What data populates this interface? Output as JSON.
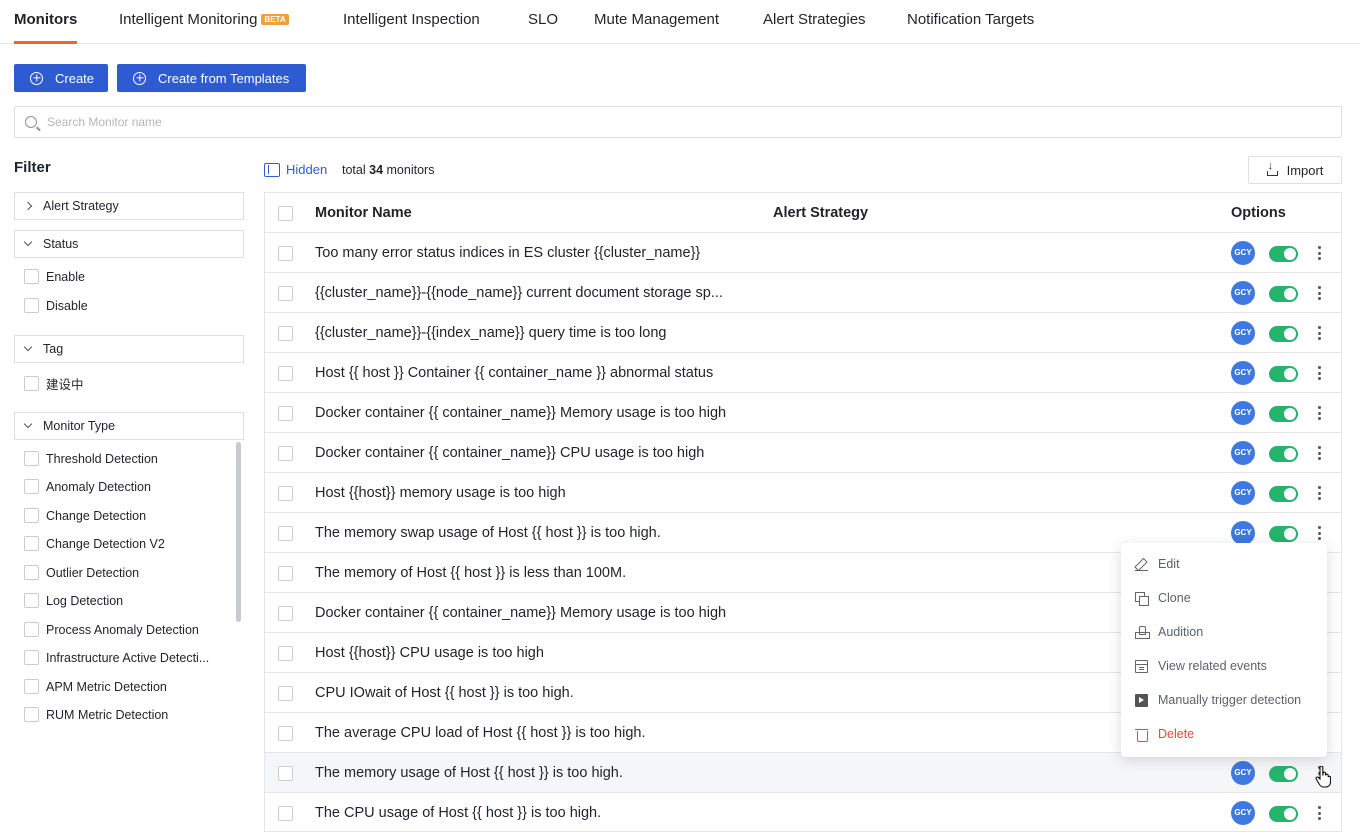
{
  "nav": {
    "tabs": [
      {
        "label": "Monitors",
        "active": true
      },
      {
        "label": "Intelligent Monitoring",
        "badge": "BETA"
      },
      {
        "label": "Intelligent Inspection"
      },
      {
        "label": "SLO"
      },
      {
        "label": "Mute Management"
      },
      {
        "label": "Alert Strategies"
      },
      {
        "label": "Notification Targets"
      }
    ]
  },
  "toolbar": {
    "create_label": "Create",
    "create_templates_label": "Create from Templates",
    "search_placeholder": "Search Monitor name",
    "hidden_label": "Hidden",
    "total_prefix": "total",
    "total_count": "34",
    "total_suffix": "monitors",
    "import_label": "Import"
  },
  "filter": {
    "title": "Filter",
    "groups": {
      "alert_strategy": "Alert Strategy",
      "status": "Status",
      "tag": "Tag",
      "monitor_type": "Monitor Type"
    },
    "status_options": [
      "Enable",
      "Disable"
    ],
    "tag_options": [
      "建设中"
    ],
    "type_options": [
      "Threshold Detection",
      "Anomaly Detection",
      "Change Detection",
      "Change Detection V2",
      "Outlier Detection",
      "Log Detection",
      "Process Anomaly Detection",
      "Infrastructure Active Detecti...",
      "APM Metric Detection",
      "RUM Metric Detection"
    ]
  },
  "table": {
    "columns": {
      "name": "Monitor Name",
      "strategy": "Alert Strategy",
      "options": "Options"
    },
    "avatar_text": "GCY",
    "rows": [
      {
        "name": "Too many error status indices in ES cluster {{cluster_name}}"
      },
      {
        "name": "{{cluster_name}}-{{node_name}} current document storage sp..."
      },
      {
        "name": "{{cluster_name}}-{{index_name}} query time is too long"
      },
      {
        "name": "Host {{ host }} Container {{ container_name }} abnormal status"
      },
      {
        "name": "Docker container {{ container_name}} Memory usage is too high"
      },
      {
        "name": "Docker container {{ container_name}} CPU usage is too high"
      },
      {
        "name": "Host {{host}} memory usage is too high"
      },
      {
        "name": "The memory swap usage of Host {{ host }} is too high."
      },
      {
        "name": "The memory of Host {{ host }} is less than 100M."
      },
      {
        "name": "Docker container {{ container_name}} Memory usage is too high"
      },
      {
        "name": "Host {{host}} CPU usage is too high"
      },
      {
        "name": "CPU IOwait of Host {{ host }} is too high."
      },
      {
        "name": "The average CPU load of Host {{ host }} is too high."
      },
      {
        "name": "The memory usage of Host {{ host }} is too high."
      },
      {
        "name": "The CPU usage of Host {{ host }} is too high."
      }
    ]
  },
  "menu": {
    "edit": "Edit",
    "clone": "Clone",
    "audition": "Audition",
    "view_events": "View related events",
    "trigger": "Manually trigger detection",
    "delete": "Delete"
  },
  "colors": {
    "primary": "#2f5bd2",
    "active_tab_underline": "#e8682a",
    "toggle_on": "#26b36b",
    "avatar": "#3e78e0",
    "danger": "#e5483f"
  }
}
